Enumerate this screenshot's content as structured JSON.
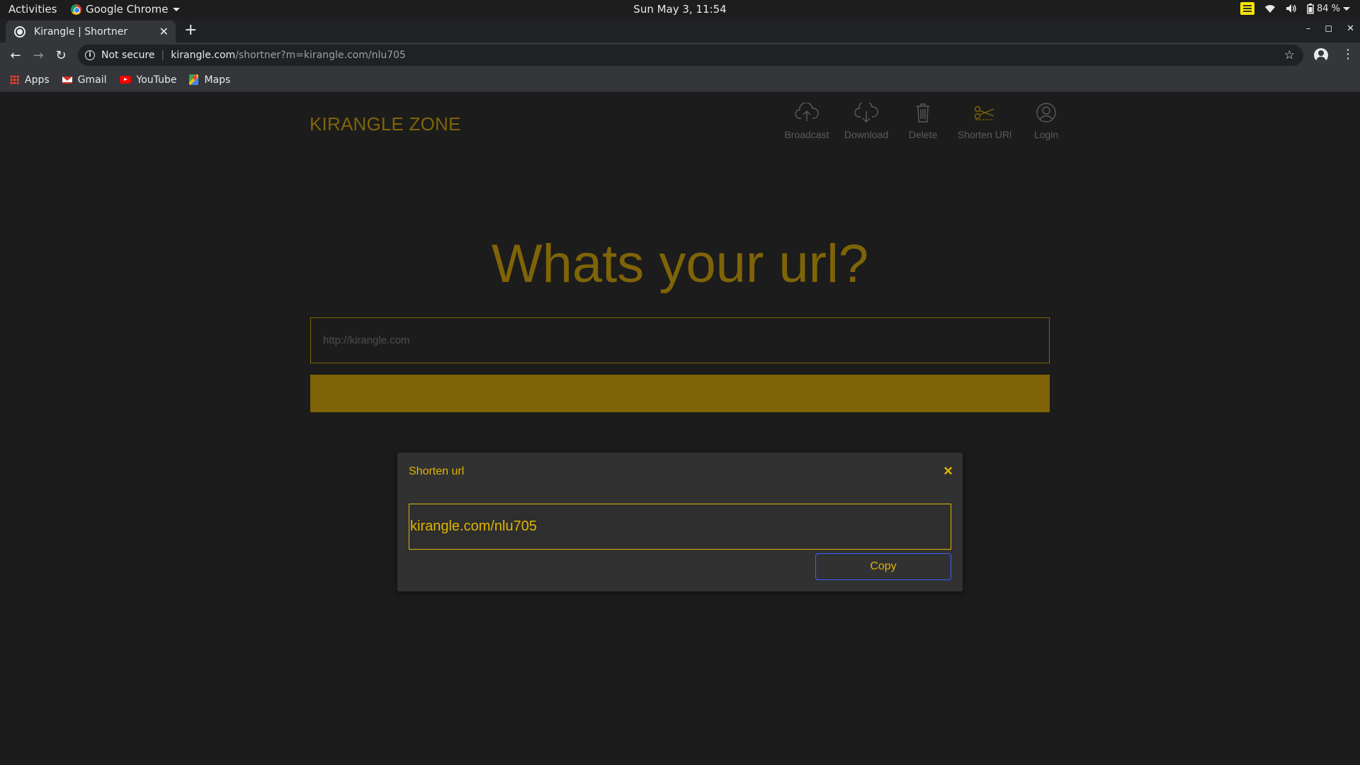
{
  "system_bar": {
    "activities": "Activities",
    "app_name": "Google Chrome",
    "clock": "Sun May  3, 11:54",
    "battery": "84 %"
  },
  "browser": {
    "tab_title": "Kirangle | Shortner",
    "security_label": "Not secure",
    "url_host": "kirangle.com",
    "url_path": "/shortner?m=kirangle.com/nlu705",
    "bookmarks": [
      "Apps",
      "Gmail",
      "YouTube",
      "Maps"
    ]
  },
  "site": {
    "brand": "KIRANGLE ZONE",
    "nav": [
      {
        "label": "Broadcast",
        "icon": "cloud-upload-icon"
      },
      {
        "label": "Download",
        "icon": "cloud-download-icon"
      },
      {
        "label": "Delete",
        "icon": "trash-icon"
      },
      {
        "label": "Shorten URl",
        "icon": "scissors-icon"
      },
      {
        "label": "Login",
        "icon": "user-icon"
      }
    ],
    "heading": "Whats your url?",
    "url_placeholder": "http://kirangle.com"
  },
  "modal": {
    "title": "Shorten url",
    "close_symbol": "×",
    "short_url": "kirangle.com/nlu705",
    "copy_label": "Copy"
  },
  "colors": {
    "accent": "#7f6407",
    "modal_accent": "#e0b400",
    "background": "#1c1c1c",
    "copy_border": "#3d5eff"
  }
}
